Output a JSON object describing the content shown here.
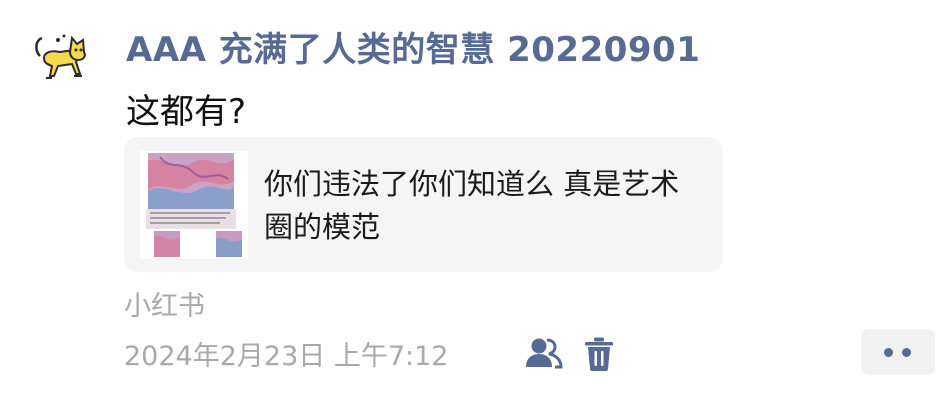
{
  "post": {
    "author": "AAA 充满了人类的智慧 20220901",
    "text": "这都有?",
    "avatar_icon": "yellow-cat-icon",
    "link": {
      "title": "你们违法了你们知道么 真是艺术圈的模范",
      "thumbnail_icon": "artwork-thumbnail-icon"
    },
    "source": "小红书",
    "timestamp": "2024年2月23日 上午7:12",
    "actions": {
      "visibility_icon": "friends-icon",
      "delete_icon": "trash-icon",
      "more_icon": "more-dots-icon"
    }
  },
  "colors": {
    "author_name": "#566a94",
    "meta_text": "#a9a9a9",
    "card_bg": "#f5f5f5",
    "action_icon": "#566a94"
  }
}
